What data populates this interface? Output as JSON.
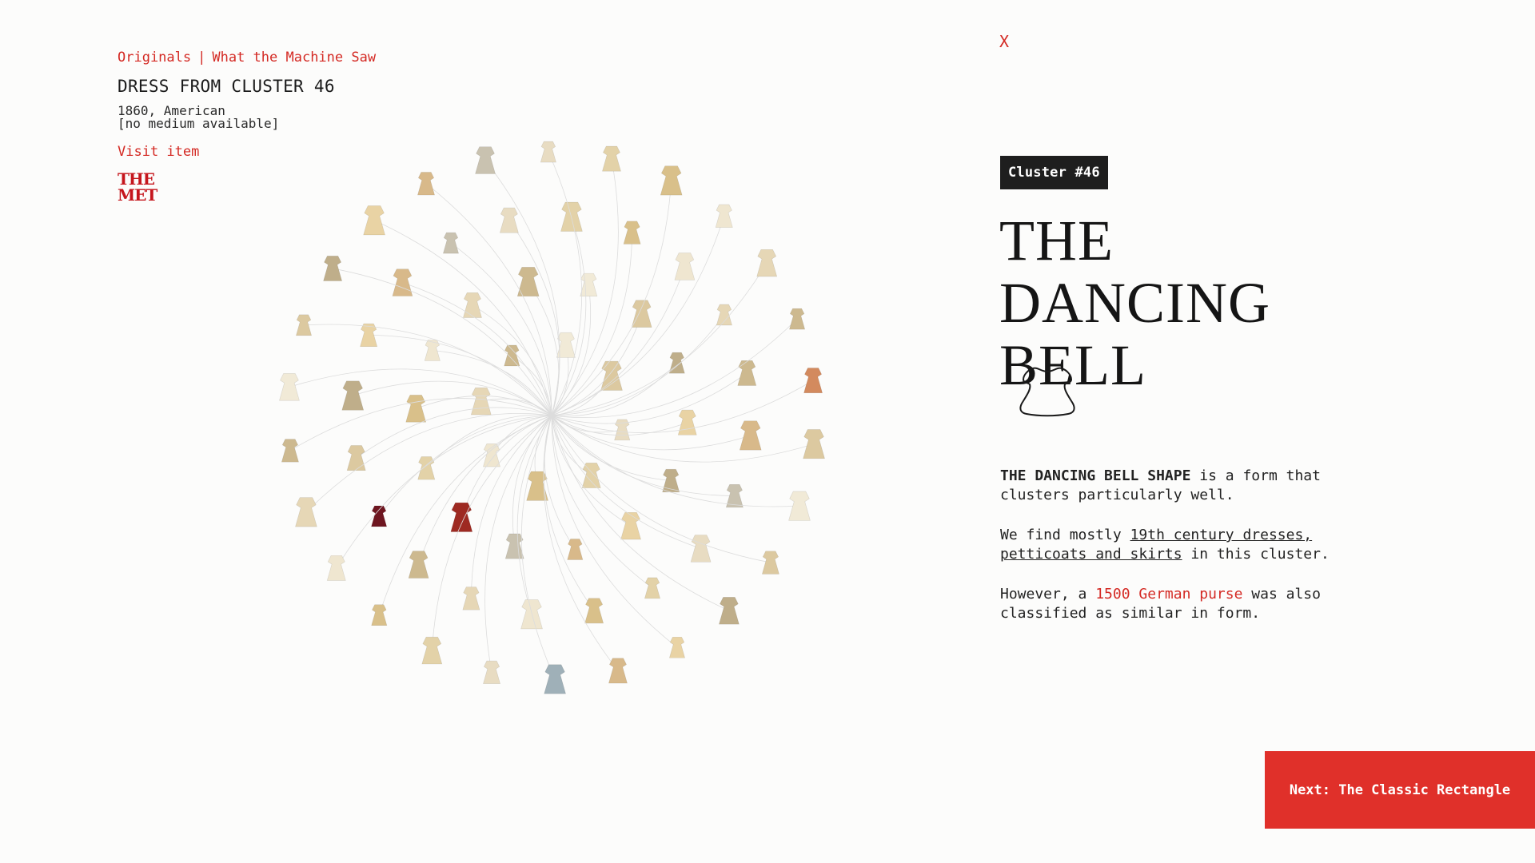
{
  "nav": {
    "originals_label": "Originals",
    "separator": "|",
    "machine_label": "What the Machine Saw",
    "close_label": "X"
  },
  "item": {
    "title": "DRESS FROM CLUSTER 46",
    "date_origin": "1860, American",
    "medium": "[no medium available]",
    "visit_label": "Visit item",
    "logo_line1": "THE",
    "logo_line2": "MET"
  },
  "cluster": {
    "badge": "Cluster #46",
    "name": "THE DANCING BELL",
    "shape_icon": "bell-dress-outline-icon",
    "para1_bold": "THE DANCING BELL SHAPE",
    "para1_rest": " is a form that clusters particularly well.",
    "para2_pre": "We find mostly ",
    "para2_link": "19th century dresses, petticoats and skirts",
    "para2_post": " in this cluster.",
    "para3_pre": "However, a ",
    "para3_link": "1500 German purse",
    "para3_post": " was also classified as similar in form."
  },
  "next": {
    "label": "Next: The Classic Rectangle"
  },
  "colors": {
    "accent": "#d42a24",
    "button": "#e0302a",
    "badge_bg": "#1e1e1e",
    "logo": "#c5161d",
    "highlight_dress": "#9e2a22",
    "selected_dress": "#6e1620"
  }
}
